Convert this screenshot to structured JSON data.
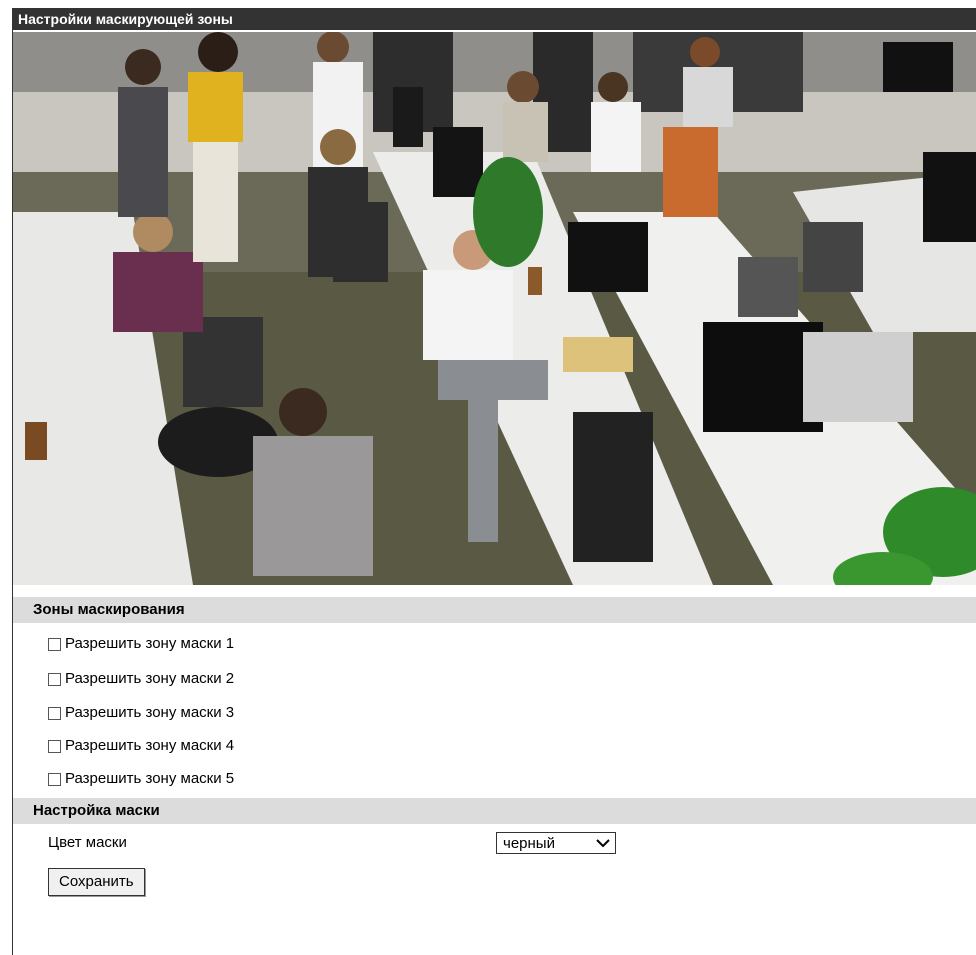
{
  "window": {
    "title": "Настройки маскирующей зоны"
  },
  "video": {
    "description_icon": "camera-preview-image"
  },
  "mask_zones": {
    "heading": "Зоны маскирования",
    "items": [
      {
        "label": "Разрешить зону маски 1",
        "checked": false
      },
      {
        "label": "Разрешить зону маски 2",
        "checked": false
      },
      {
        "label": "Разрешить зону маски 3",
        "checked": false
      },
      {
        "label": "Разрешить зону маски 4",
        "checked": false
      },
      {
        "label": "Разрешить зону маски 5",
        "checked": false
      }
    ]
  },
  "mask_settings": {
    "heading": "Настройка маски",
    "color_label": "Цвет маски",
    "color_value": "черный",
    "save_label": "Сохранить"
  }
}
